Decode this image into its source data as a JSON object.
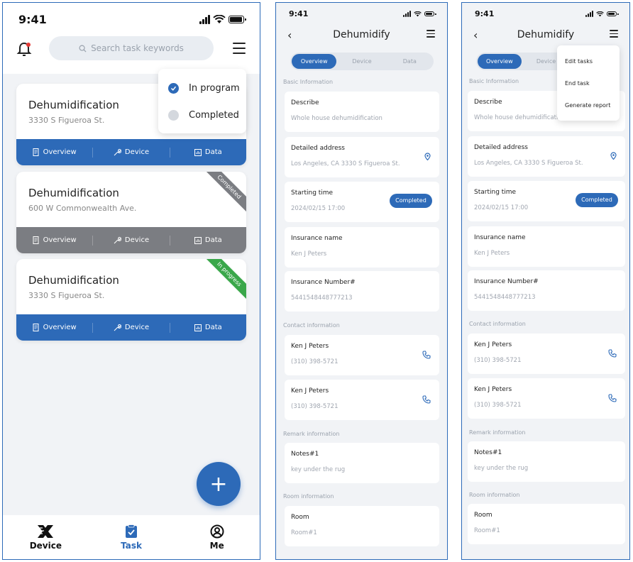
{
  "status": {
    "time": "9:41"
  },
  "list_screen": {
    "search": {
      "placeholder": "Search task keywords"
    },
    "filter_popup": {
      "options": [
        {
          "label": "In program",
          "checked": true
        },
        {
          "label": "Completed",
          "checked": false
        }
      ]
    },
    "tasks": [
      {
        "title": "Dehumidification",
        "address": "3330 S Figueroa St.",
        "ribbon": "",
        "color": "#2d6ab8"
      },
      {
        "title": "Dehumidification",
        "address": "600 W Commonwealth Ave.",
        "ribbon": "Completed",
        "ribbon_color": "#7b7d82",
        "color": "#7b7d82"
      },
      {
        "title": "Dehumidification",
        "address": "3330 S Figueroa St.",
        "ribbon": "In progress",
        "ribbon_color": "#3aa74a",
        "color": "#2d6ab8"
      }
    ],
    "task_actions": [
      "Overview",
      "Device",
      "Data"
    ],
    "fab_label": "+",
    "tabbar": [
      {
        "label": "Device",
        "active": false
      },
      {
        "label": "Task",
        "active": true
      },
      {
        "label": "Me",
        "active": false
      }
    ]
  },
  "detail": {
    "title": "Dehumidify",
    "tabs": [
      "Overview",
      "Device",
      "Data"
    ],
    "sections": {
      "basic": "Basic Information",
      "contact": "Contact information",
      "remark": "Remark information",
      "room": "Room information"
    },
    "fields": {
      "describe": {
        "label": "Describe",
        "value": "Whole house dehumidification"
      },
      "address": {
        "label": "Detailed address",
        "value": "Los Angeles, CA   3330 S Figueroa St."
      },
      "start": {
        "label": "Starting time",
        "value": "2024/02/15 17:00",
        "badge": "Completed"
      },
      "ins_name": {
        "label": "Insurance name",
        "value": "Ken J Peters"
      },
      "ins_num": {
        "label": "Insurance Number#",
        "value": "5441548448777213"
      },
      "contact1": {
        "label": "Ken J Peters",
        "value": "(310) 398-5721"
      },
      "contact2": {
        "label": "Ken J Peters",
        "value": "(310) 398-5721"
      },
      "notes": {
        "label": "Notes#1",
        "value": "key under the rug"
      },
      "room": {
        "label": "Room",
        "value": "Room#1"
      }
    },
    "menu": [
      "Edit tasks",
      "End task",
      "Generate report"
    ]
  },
  "colors": {
    "primary": "#2d6ab8",
    "gray": "#7b7d82",
    "green": "#3aa74a"
  }
}
